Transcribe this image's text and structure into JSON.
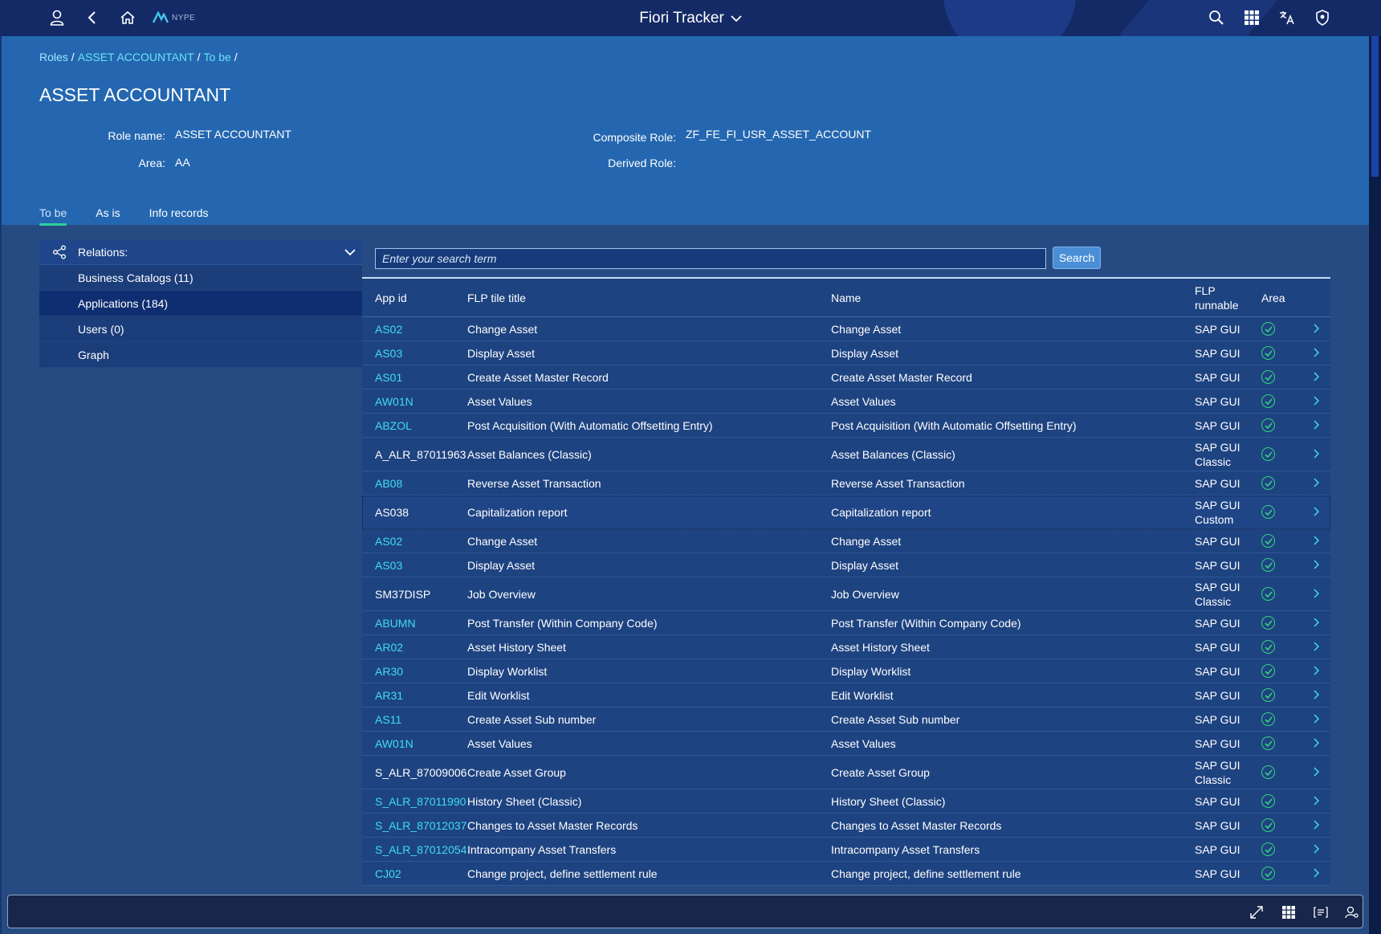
{
  "shell": {
    "title": "Fiori Tracker",
    "logo_text": "NYPE",
    "icons": [
      "user-icon",
      "back-icon",
      "home-icon",
      "search-icon",
      "app-grid-icon",
      "translate-icon",
      "shield-icon"
    ]
  },
  "breadcrumb": {
    "items": [
      "Roles",
      "ASSET ACCOUNTANT",
      "To be"
    ],
    "separator": "/"
  },
  "page": {
    "title": "ASSET ACCOUNTANT"
  },
  "attributes": {
    "role_name_label": "Role name:",
    "role_name_value": "ASSET ACCOUNTANT",
    "area_label": "Area:",
    "area_value": "AA",
    "composite_label": "Composite Role:",
    "composite_value": "ZF_FE_FI_USR_ASSET_ACCOUNT",
    "derived_label": "Derived Role:",
    "derived_value": ""
  },
  "tabs": [
    {
      "label": "To be",
      "active": true
    },
    {
      "label": "As is",
      "active": false
    },
    {
      "label": "Info records",
      "active": false
    }
  ],
  "relations": {
    "header": "Relations:",
    "items": [
      {
        "label": "Business Catalogs (11)",
        "selected": false
      },
      {
        "label": "Applications (184)",
        "selected": true
      },
      {
        "label": "Users (0)",
        "selected": false
      },
      {
        "label": "Graph",
        "selected": false
      }
    ]
  },
  "search": {
    "placeholder": "Enter your search term",
    "button": "Search"
  },
  "table": {
    "columns": {
      "app_id": "App id",
      "flp_title": "FLP tile title",
      "name": "Name",
      "flp_runnable": "FLP runnable",
      "area": "Area"
    },
    "rows": [
      {
        "id": "AS02",
        "link": true,
        "flp": "Change Asset",
        "name": "Change Asset",
        "runnable": "SAP GUI"
      },
      {
        "id": "AS03",
        "link": true,
        "flp": "Display Asset",
        "name": "Display Asset",
        "runnable": "SAP GUI"
      },
      {
        "id": "AS01",
        "link": true,
        "flp": "Create Asset Master Record",
        "name": "Create Asset Master Record",
        "runnable": "SAP GUI"
      },
      {
        "id": "AW01N",
        "link": true,
        "flp": "Asset Values",
        "name": "Asset Values",
        "runnable": "SAP GUI"
      },
      {
        "id": "ABZOL",
        "link": true,
        "flp": "Post Acquisition (With Automatic Offsetting Entry)",
        "name": "Post Acquisition (With Automatic Offsetting Entry)",
        "runnable": "SAP GUI"
      },
      {
        "id": "A_ALR_87011963",
        "link": false,
        "flp": "Asset Balances (Classic)",
        "name": "Asset Balances (Classic)",
        "runnable": "SAP GUI Classic"
      },
      {
        "id": "AB08",
        "link": true,
        "flp": "Reverse Asset Transaction",
        "name": "Reverse Asset Transaction",
        "runnable": "SAP GUI"
      },
      {
        "id": "AS038",
        "link": false,
        "flp": "Capitalization report",
        "name": "Capitalization report",
        "runnable": "SAP GUI Custom",
        "focus": true
      },
      {
        "id": "AS02",
        "link": true,
        "flp": "Change Asset",
        "name": "Change Asset",
        "runnable": "SAP GUI"
      },
      {
        "id": "AS03",
        "link": true,
        "flp": "Display Asset",
        "name": "Display Asset",
        "runnable": "SAP GUI"
      },
      {
        "id": "SM37DISP",
        "link": false,
        "flp": "Job Overview",
        "name": "Job Overview",
        "runnable": "SAP GUI Classic"
      },
      {
        "id": "ABUMN",
        "link": true,
        "flp": "Post Transfer (Within Company Code)",
        "name": "Post Transfer (Within Company Code)",
        "runnable": "SAP GUI"
      },
      {
        "id": "AR02",
        "link": true,
        "flp": "Asset History Sheet",
        "name": "Asset History Sheet",
        "runnable": "SAP GUI"
      },
      {
        "id": "AR30",
        "link": true,
        "flp": "Display Worklist",
        "name": "Display Worklist",
        "runnable": "SAP GUI"
      },
      {
        "id": "AR31",
        "link": true,
        "flp": "Edit Worklist",
        "name": "Edit Worklist",
        "runnable": "SAP GUI"
      },
      {
        "id": "AS11",
        "link": true,
        "flp": "Create Asset Sub number",
        "name": "Create Asset Sub number",
        "runnable": "SAP GUI"
      },
      {
        "id": "AW01N",
        "link": true,
        "flp": "Asset Values",
        "name": "Asset Values",
        "runnable": "SAP GUI"
      },
      {
        "id": "S_ALR_87009006",
        "link": false,
        "flp": "Create Asset Group",
        "name": "Create Asset Group",
        "runnable": "SAP GUI Classic"
      },
      {
        "id": "S_ALR_87011990",
        "link": true,
        "flp": "History Sheet (Classic)",
        "name": "History Sheet (Classic)",
        "runnable": "SAP GUI"
      },
      {
        "id": "S_ALR_87012037",
        "link": true,
        "flp": "Changes to Asset Master Records",
        "name": "Changes to Asset Master Records",
        "runnable": "SAP GUI"
      },
      {
        "id": "S_ALR_87012054",
        "link": true,
        "flp": "Intracompany Asset Transfers",
        "name": "Intracompany Asset Transfers",
        "runnable": "SAP GUI"
      },
      {
        "id": "CJ02",
        "link": true,
        "flp": "Change project, define settlement rule",
        "name": "Change project, define settlement rule",
        "runnable": "SAP GUI"
      }
    ]
  },
  "bottom_toolbar": {
    "icons": [
      "expand-icon",
      "grid-icon",
      "list-icon",
      "user-settings-icon"
    ]
  },
  "colors": {
    "shell": "#142a66",
    "header": "#2467b0",
    "body": "#264b82",
    "link": "#3fdcf2",
    "tab_indicator": "#2bd399",
    "check": "#35d27f"
  }
}
